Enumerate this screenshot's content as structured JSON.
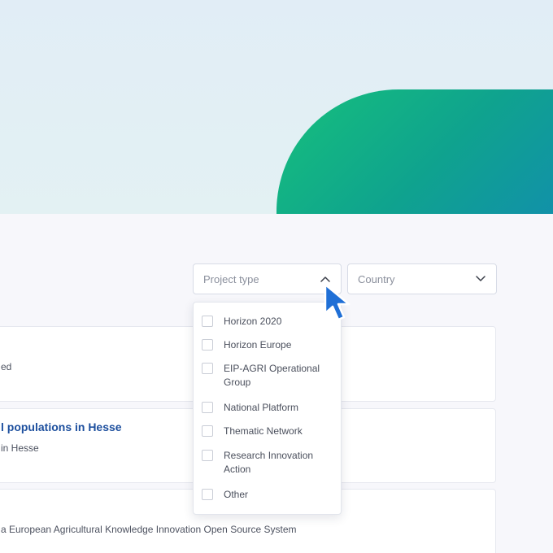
{
  "filters": {
    "project_type": {
      "placeholder": "Project type",
      "options": [
        "Horizon 2020",
        "Horizon Europe",
        "EIP-AGRI Operational Group",
        "National Platform",
        "Thematic Network",
        "Research Innovation Action",
        "Other"
      ]
    },
    "country": {
      "placeholder": "Country"
    }
  },
  "cards": [
    {
      "title": "",
      "subtitle": "ed"
    },
    {
      "title": "l populations in Hesse",
      "subtitle": "in Hesse"
    },
    {
      "title": "",
      "subtitle": "a European Agricultural Knowledge Innovation Open Source System"
    }
  ],
  "colors": {
    "accent_green": "#16c07c",
    "accent_blue": "#1387b8",
    "title_blue": "#1d4f9e",
    "cursor_blue": "#1f6fd6"
  },
  "icons": {
    "chevron_up": "chevron-up-icon",
    "chevron_down": "chevron-down-icon",
    "cursor": "mouse-pointer-icon"
  }
}
